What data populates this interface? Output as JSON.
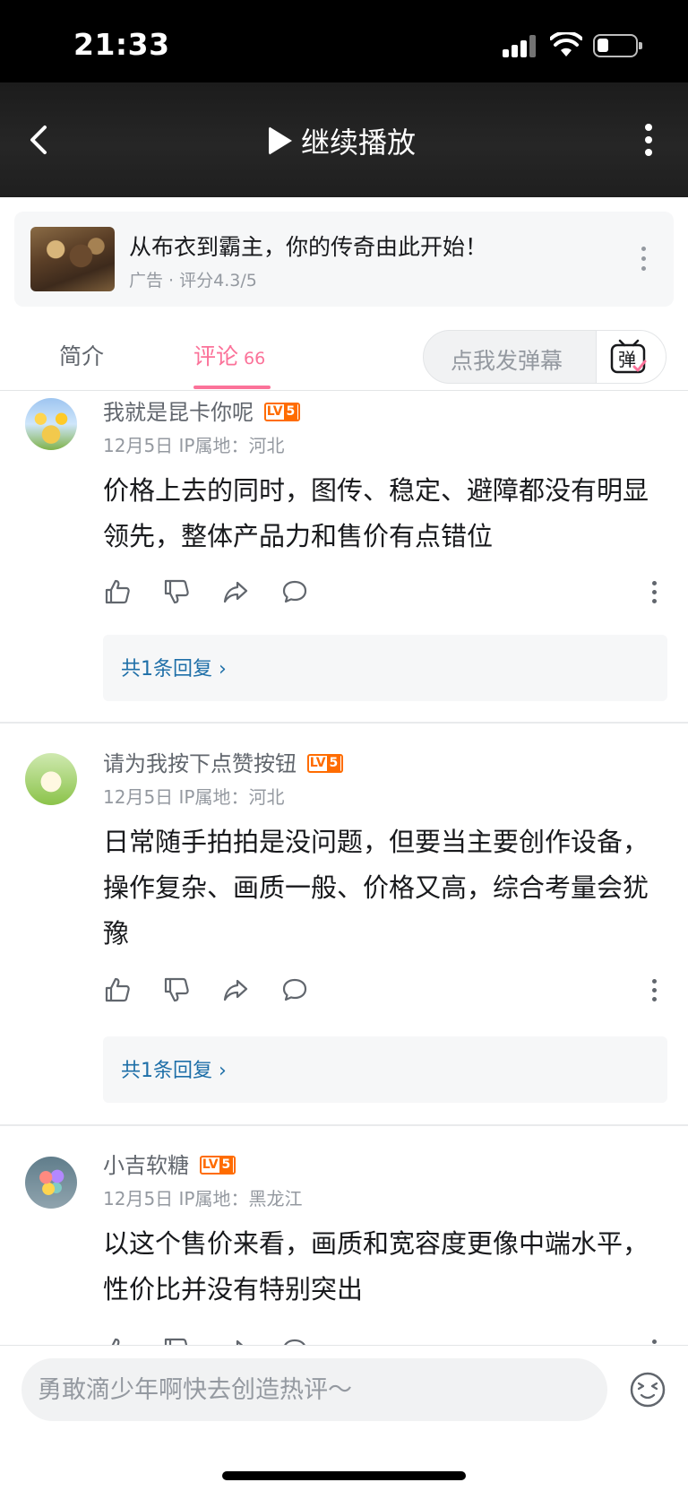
{
  "status_bar": {
    "time": "21:33"
  },
  "header": {
    "resume_label": "继续播放"
  },
  "ad": {
    "title": "从布衣到霸主，你的传奇由此开始！",
    "subtitle": "广告 · 评分4.3/5"
  },
  "tabs": {
    "intro_label": "简介",
    "comments_label": "评论",
    "comments_count": "66",
    "danmaku_placeholder": "点我发弹幕",
    "danmaku_icon_char": "弹"
  },
  "comments": [
    {
      "username": "我就是昆卡你呢",
      "level": "5",
      "meta": "12月5日  IP属地：河北",
      "text": "价格上去的同时，图传、稳定、避障都没有明显领先，整体产品力和售价有点错位",
      "reply_label": "共1条回复 ›"
    },
    {
      "username": "请为我按下点赞按钮",
      "level": "5",
      "meta": "12月5日  IP属地：河北",
      "text": "日常随手拍拍是没问题，但要当主要创作设备，操作复杂、画质一般、价格又高，综合考量会犹豫",
      "reply_label": "共1条回复 ›"
    },
    {
      "username": "小吉软糖",
      "level": "5",
      "meta": "12月5日  IP属地：黑龙江",
      "text": "以这个售价来看，画质和宽容度更像中端水平，性价比并没有特别突出"
    }
  ],
  "bottom": {
    "input_placeholder": "勇敢滴少年啊快去创造热评～"
  },
  "colors": {
    "accent": "#fb7299",
    "level": "#ff6c00",
    "reply_link": "#1e6fa8"
  }
}
